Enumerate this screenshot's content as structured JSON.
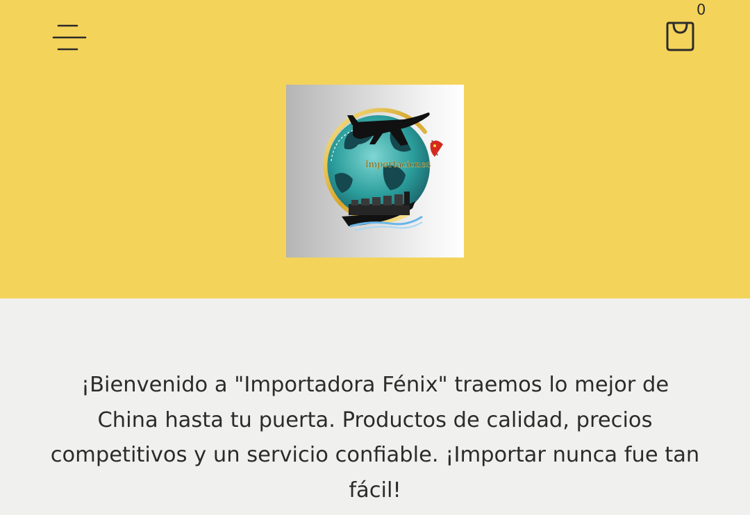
{
  "header": {
    "background_color": "#f4d35a",
    "menu_icon": "hamburger-menu-icon",
    "cart_icon": "shopping-bag-icon",
    "cart_count": "0"
  },
  "logo": {
    "text": "Importaciones"
  },
  "main": {
    "background_color": "#f0f1ef",
    "welcome_text": "¡Bienvenido a \"Importadora Fénix\" traemos lo mejor de China hasta tu puerta. Productos de calidad, precios competitivos y un servicio confiable. ¡Importar nunca fue tan fácil!"
  }
}
